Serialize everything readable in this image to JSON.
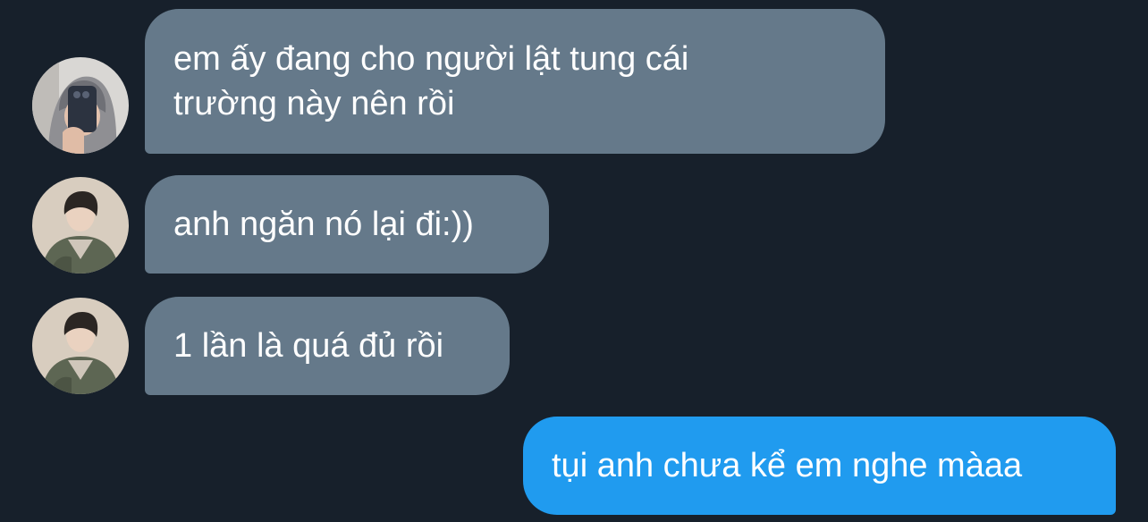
{
  "messages": [
    {
      "direction": "incoming",
      "sender_avatar": "hoodie-mirror-selfie-avatar",
      "text": "em ấy đang cho người lật tung cái\ntrường này nên rồi"
    },
    {
      "direction": "incoming",
      "sender_avatar": "jacket-boy-avatar",
      "text": "anh ngăn nó lại đi:))"
    },
    {
      "direction": "incoming",
      "sender_avatar": "jacket-boy-avatar",
      "text": "1 lần là quá đủ rồi"
    },
    {
      "direction": "outgoing",
      "text": "tụi anh chưa kể em nghe màaa"
    }
  ],
  "colors": {
    "background": "#17202b",
    "incoming_bubble": "#65798a",
    "outgoing_bubble": "#209bef",
    "text": "#ffffff"
  }
}
